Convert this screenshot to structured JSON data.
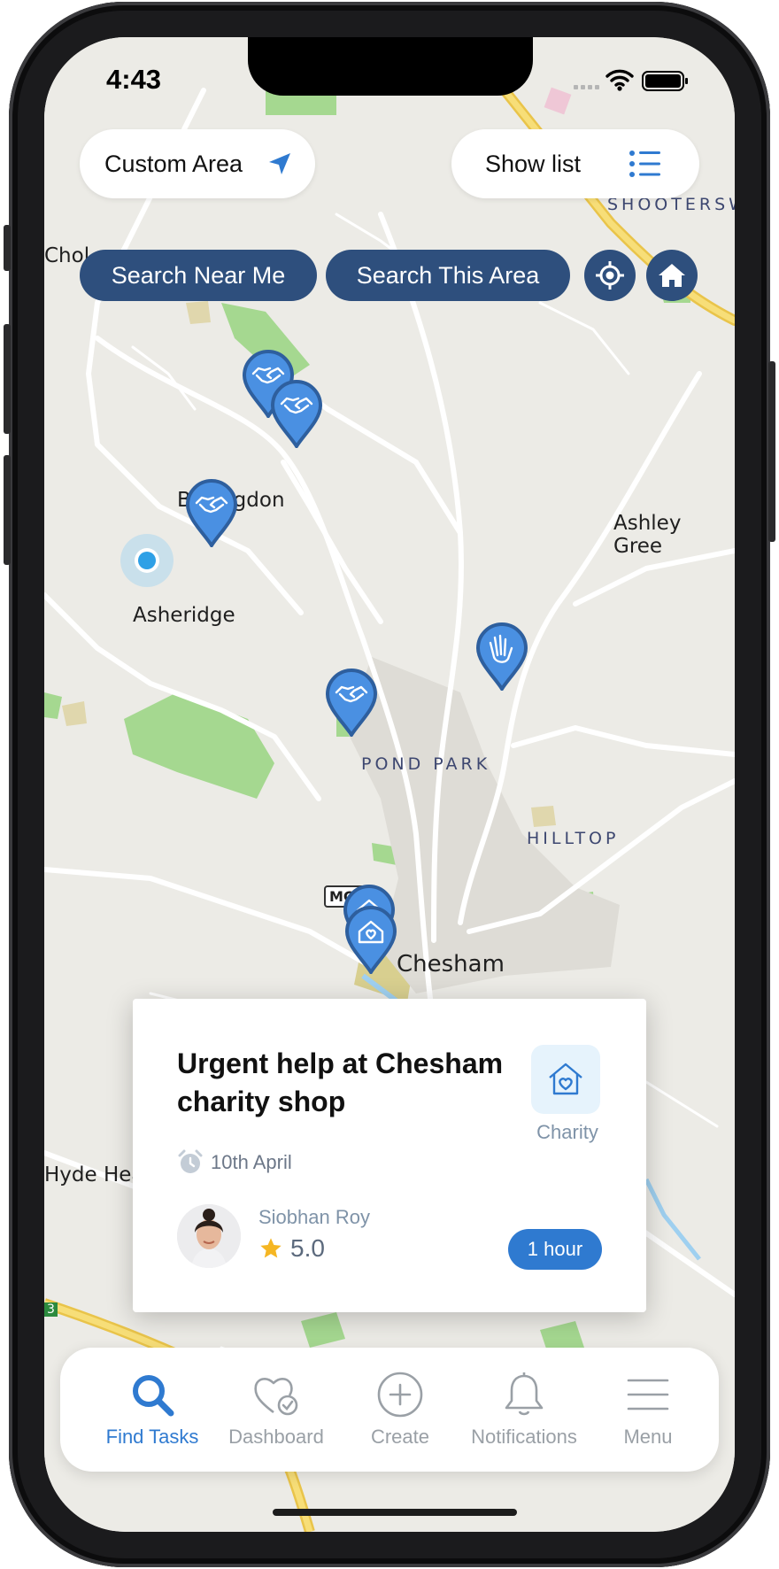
{
  "status_bar": {
    "time": "4:43"
  },
  "top_controls": {
    "custom_area_label": "Custom Area",
    "show_list_label": "Show list",
    "search_near_me_label": "Search Near Me",
    "search_this_area_label": "Search This Area"
  },
  "map": {
    "labels": {
      "chol": "Chol",
      "shootersw": "SHOOTERSW",
      "bellingdon": "Bellingdon",
      "ashley_green": "Ashley Gree",
      "asheridge": "Asheridge",
      "pond_park": "POND PARK",
      "hilltop": "HILLTOP",
      "mc2": "MC2",
      "chesham": "Chesham",
      "hyde_heath": "Hyde Hea",
      "road_3": "3"
    },
    "pins": [
      {
        "type": "handshake"
      },
      {
        "type": "handshake"
      },
      {
        "type": "handshake"
      },
      {
        "type": "waving-hand"
      },
      {
        "type": "handshake"
      },
      {
        "type": "charity"
      },
      {
        "type": "charity"
      }
    ]
  },
  "task_card": {
    "title": "Urgent help at Chesham charity shop",
    "category": "Charity",
    "date": "10th April",
    "user_name": "Siobhan Roy",
    "rating": "5.0",
    "duration": "1 hour"
  },
  "tab_bar": {
    "tabs": [
      {
        "label": "Find Tasks",
        "icon": "search-icon",
        "active": true
      },
      {
        "label": "Dashboard",
        "icon": "heart-check-icon",
        "active": false
      },
      {
        "label": "Create",
        "icon": "plus-circle-icon",
        "active": false
      },
      {
        "label": "Notifications",
        "icon": "bell-icon",
        "active": false
      },
      {
        "label": "Menu",
        "icon": "hamburger-icon",
        "active": false
      }
    ]
  },
  "colors": {
    "primary_blue": "#2e4f7d",
    "accent_blue": "#2f7ad0",
    "pin_blue": "#4a90e2",
    "map_bg": "#ecebe6"
  }
}
